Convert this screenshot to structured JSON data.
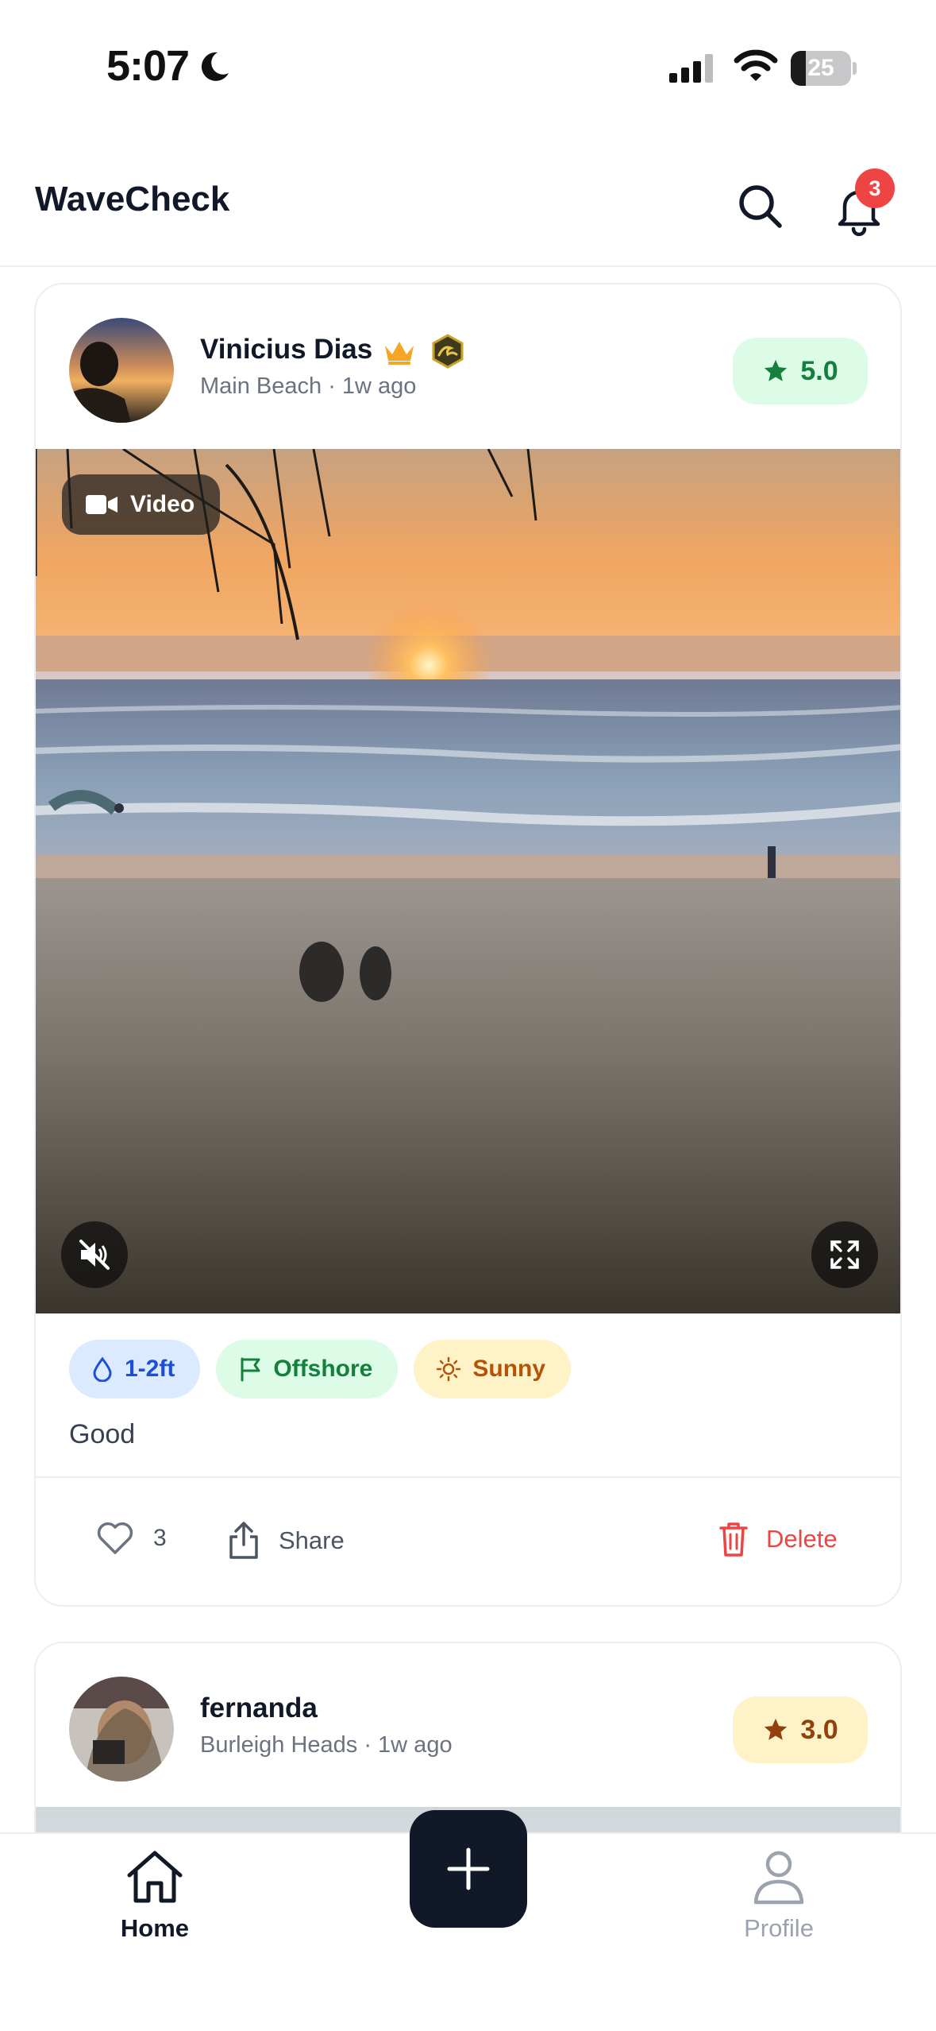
{
  "status_bar": {
    "time": "5:07",
    "battery_percent": 25,
    "battery_label": "25"
  },
  "header": {
    "title": "WaveCheck",
    "notification_count": "3"
  },
  "posts": [
    {
      "author": "Vinicius Dias",
      "location_time": "Main Beach · 1w ago",
      "rating": "5.0",
      "media_badge": "Video",
      "tags": [
        "1-2ft",
        "Offshore",
        "Sunny"
      ],
      "caption": "Good",
      "likes": "3",
      "share_label": "Share",
      "delete_label": "Delete"
    },
    {
      "author": "fernanda",
      "location_time": "Burleigh Heads · 1w ago",
      "rating": "3.0"
    }
  ],
  "nav": {
    "home_label": "Home",
    "profile_label": "Profile"
  },
  "colors": {
    "rating_high": "#15803d",
    "rating_mid": "#92400e",
    "delete": "#ef4444",
    "badge": "#ef4444",
    "primary_dark": "#111827"
  }
}
